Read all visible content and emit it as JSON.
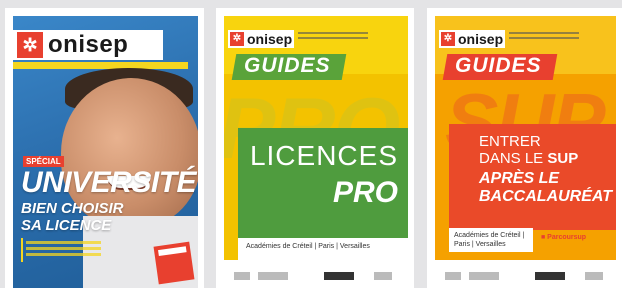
{
  "covers": [
    {
      "brand": "onisep",
      "brand_mark": "✲",
      "issue": "",
      "special": "SPÉCIAL",
      "title": "UNIVERSITÉ",
      "subtitle": "BIEN CHOISIR SA LICENCE"
    },
    {
      "brand": "onisep",
      "brand_mark": "✲",
      "series": "GUIDES",
      "edition": "",
      "ghost": "PRO",
      "title_line1": "LICENCES",
      "title_line2": "PRO",
      "region": "Académies de Créteil | Paris | Versailles"
    },
    {
      "brand": "onisep",
      "brand_mark": "✲",
      "series": "GUIDES",
      "edition": "",
      "ghost": "SUP",
      "title_line1": "ENTRER",
      "title_line2_a": "DANS LE ",
      "title_line2_b": "SUP",
      "title_line3": "APRÈS LE",
      "title_line4": "BACCALAURÉAT",
      "region": "Académies de Créteil | Paris | Versailles",
      "badge": "■ Parcoursup"
    }
  ],
  "colors": {
    "brand_red": "#e8402f",
    "pro_green": "#4f9c3e",
    "pro_yellow": "#f3c200",
    "sup_orange": "#f5a100",
    "univ_blue": "#2c6fae"
  }
}
